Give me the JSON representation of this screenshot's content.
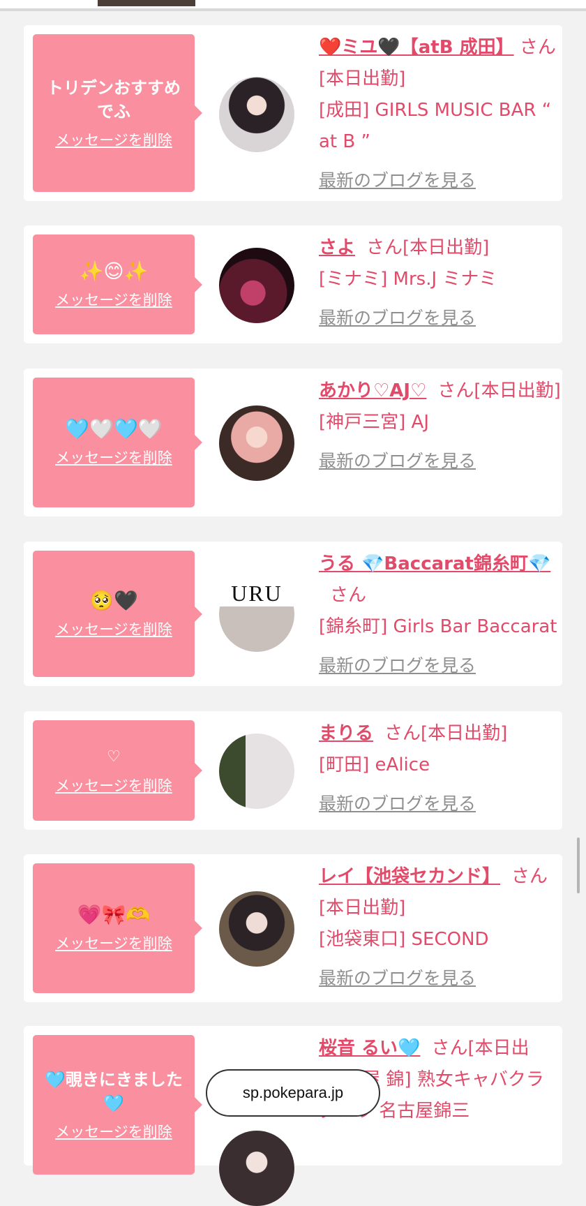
{
  "cards": [
    {
      "message": "トリデンおすすめでふ",
      "delete_label": "メッセージを削除",
      "name": "❤️ミユ🖤【atB 成田】",
      "suffix": "さん[本日出勤]",
      "shop": "[成田] GIRLS MUSIC BAR “ at B ”",
      "blog_label": "最新のブログを見る",
      "avatar_icon": "avatar-photo"
    },
    {
      "message": "✨😊✨",
      "delete_label": "メッセージを削除",
      "name": "さよ",
      "suffix": "さん[本日出勤]",
      "shop": "[ミナミ] Mrs.J ミナミ",
      "blog_label": "最新のブログを見る",
      "avatar_icon": "avatar-photo"
    },
    {
      "message": "🩵🤍🩵🤍",
      "delete_label": "メッセージを削除",
      "name": "あかり♡AJ♡",
      "suffix": "さん[本日出勤]",
      "shop": "[神戸三宮] AJ",
      "blog_label": "最新のブログを見る",
      "avatar_icon": "avatar-photo"
    },
    {
      "message": "🥺🖤",
      "delete_label": "メッセージを削除",
      "name": "うる 💎Baccarat錦糸町💎",
      "suffix": "さん",
      "shop": "[錦糸町] Girls Bar Baccarat",
      "blog_label": "最新のブログを見る",
      "avatar_icon": "avatar-photo",
      "avatar_text": "URU"
    },
    {
      "message": "♡",
      "delete_label": "メッセージを削除",
      "name": "まりる",
      "suffix": "さん[本日出勤]",
      "shop": "[町田] eAlice",
      "blog_label": "最新のブログを見る",
      "avatar_icon": "avatar-photo"
    },
    {
      "message": "💗🎀🫶",
      "delete_label": "メッセージを削除",
      "name": "レイ【池袋セカンド】",
      "suffix": "さん[本日出勤]",
      "shop": "[池袋東口] SECOND",
      "blog_label": "最新のブログを見る",
      "avatar_icon": "avatar-photo"
    },
    {
      "message": "🩵覗きにきました🩵",
      "delete_label": "メッセージを削除",
      "name": "桜音 るい🩵",
      "suffix": "さん[本日出",
      "shop": "[名古屋 錦] 熟女キャバクラ ダロウ 名古屋錦三",
      "blog_label": "",
      "avatar_icon": "avatar-photo"
    }
  ],
  "browser": {
    "url": "sp.pokepara.jp"
  },
  "colors": {
    "bubble": "#fa909f",
    "accent": "#e24a6a",
    "link_gray": "#8f8f8f",
    "background": "#f2f2f2"
  }
}
